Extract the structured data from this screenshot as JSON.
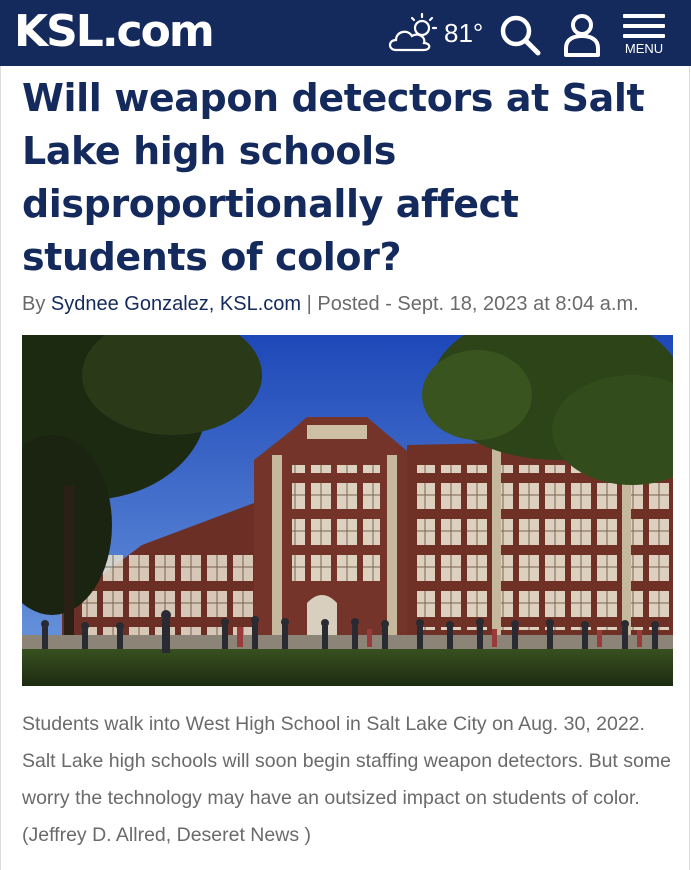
{
  "header": {
    "logo_text": "KSL.com",
    "weather": {
      "icon": "partly-cloudy-icon",
      "temperature": "81°"
    },
    "search_icon": "search-icon",
    "user_icon": "user-icon",
    "menu_label": "MENU",
    "background_color": "#142a5c"
  },
  "article": {
    "headline": "Will weapon detectors at Salt Lake high schools disproportionally affect students of color?",
    "byline_prefix": "By",
    "author": "Sydnee Gonzalez, KSL.com",
    "separator": "|",
    "posted_label": "Posted - Sept. 18, 2023 at 8:04 a.m.",
    "caption": "Students walk into West High School in Salt Lake City on Aug. 30, 2022. Salt Lake high schools will soon begin staffing weapon detectors. But some worry the technology may have an outsized impact on students of color. (Jeffrey D. Allred, Deseret News )",
    "headline_color": "#142a5c"
  }
}
